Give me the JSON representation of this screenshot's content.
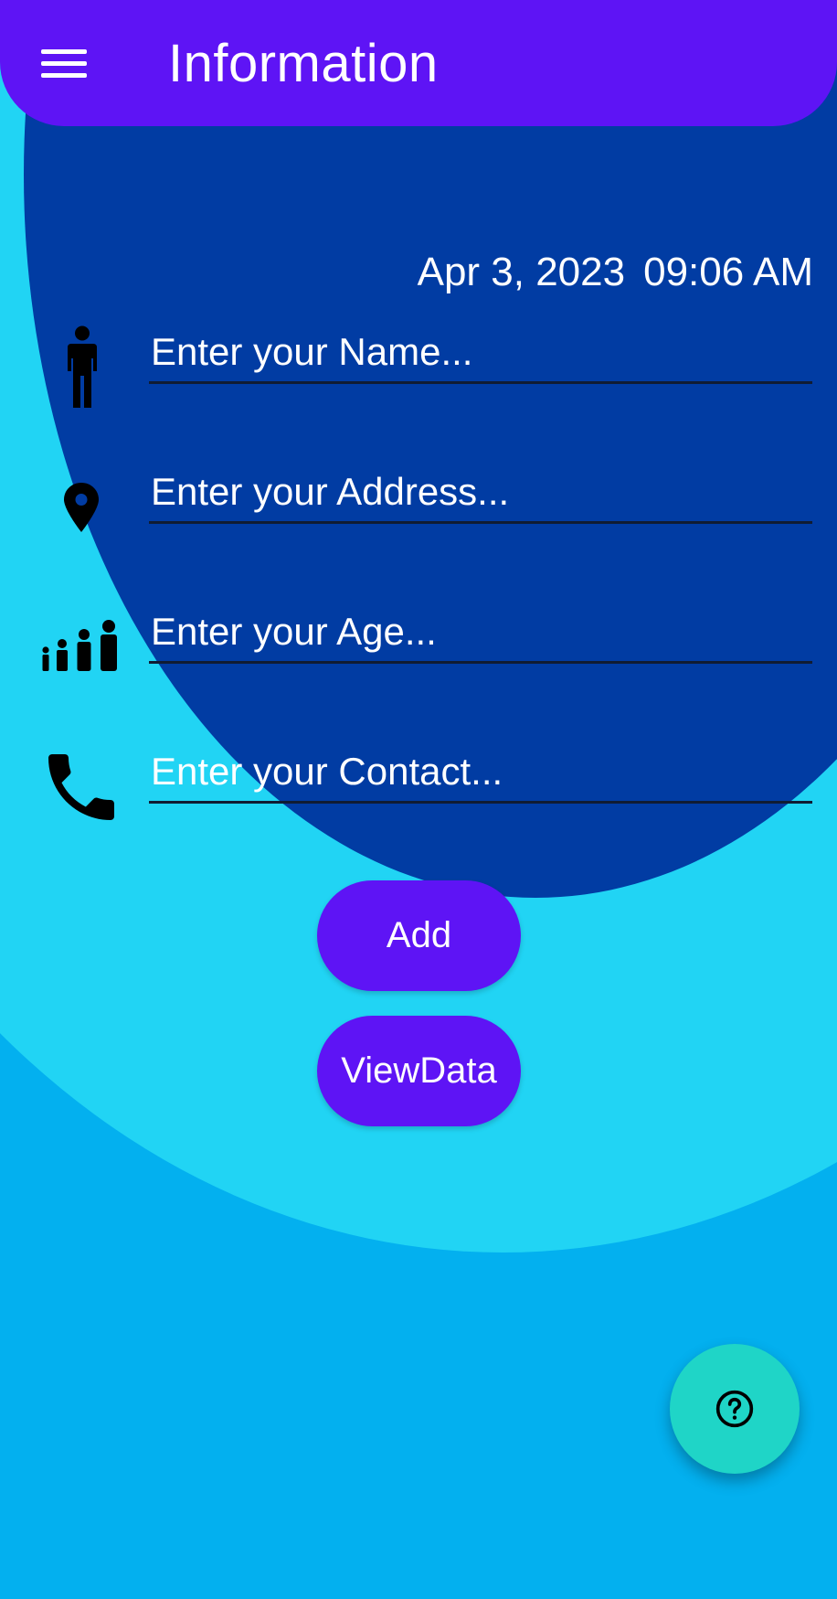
{
  "app_bar": {
    "title": "Information",
    "menu_icon": "hamburger-menu-icon"
  },
  "datetime": {
    "date": "Apr 3, 2023",
    "time": "09:06 AM"
  },
  "form": {
    "fields": [
      {
        "id": "name",
        "icon": "person-icon",
        "placeholder": "Enter your Name...",
        "value": ""
      },
      {
        "id": "address",
        "icon": "location-pin-icon",
        "placeholder": "Enter your Address...",
        "value": ""
      },
      {
        "id": "age",
        "icon": "family-age-icon",
        "placeholder": "Enter your Age...",
        "value": ""
      },
      {
        "id": "contact",
        "icon": "phone-icon",
        "placeholder": "Enter your Contact...",
        "value": ""
      }
    ]
  },
  "buttons": {
    "add_label": "Add",
    "view_data_label": "ViewData"
  },
  "fab": {
    "icon": "help-icon"
  },
  "colors": {
    "app_bar": "#5e14f5",
    "button": "#5e14f5",
    "dark_oval": "#013ca3",
    "light_arc": "#21d4f4",
    "background": "#03b0ef",
    "fab": "#1fd5c7",
    "icon": "#000000",
    "text": "#ffffff"
  }
}
